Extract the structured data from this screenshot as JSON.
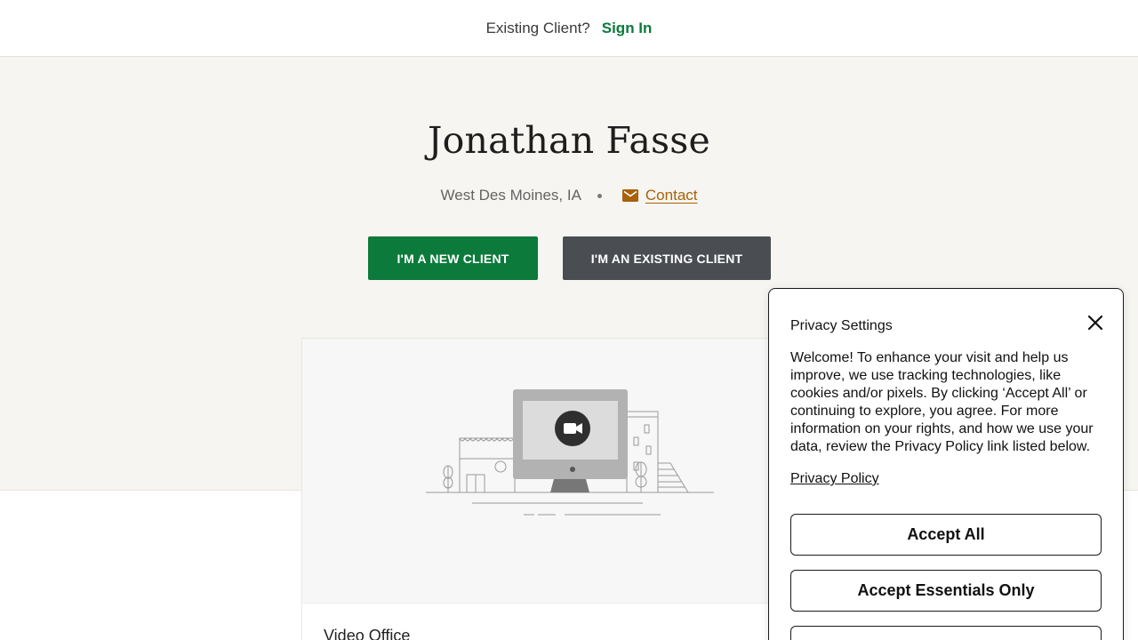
{
  "topbar": {
    "question": "Existing Client?",
    "signin": "Sign In"
  },
  "profile": {
    "name": "Jonathan Fasse",
    "location": "West Des Moines, IA",
    "contact": "Contact",
    "new_client_button": "I'M A NEW CLIENT",
    "existing_client_button": "I'M AN EXISTING CLIENT"
  },
  "office_card": {
    "title": "Video Office",
    "illustration": "video-office-illustration"
  },
  "privacy": {
    "title": "Privacy Settings",
    "body": "Welcome! To enhance your visit and help us improve, we use tracking technologies, like cookies and/or pixels. By clicking ‘Accept All’ or continuing to explore, you agree. For more information on your rights, and how we use your data, review the Privacy Policy link listed below.",
    "policy_link": "Privacy Policy",
    "accept_all": "Accept All",
    "accept_essentials": "Accept Essentials Only",
    "third_button": ""
  },
  "colors": {
    "green": "#0b7a3b",
    "dark_gray": "#4a4e53",
    "contact_gold": "#a8620a",
    "hero_bg": "#f6f5f1"
  },
  "icons": {
    "mail": "mail-icon",
    "close": "close-icon",
    "video": "video-camera-icon"
  }
}
